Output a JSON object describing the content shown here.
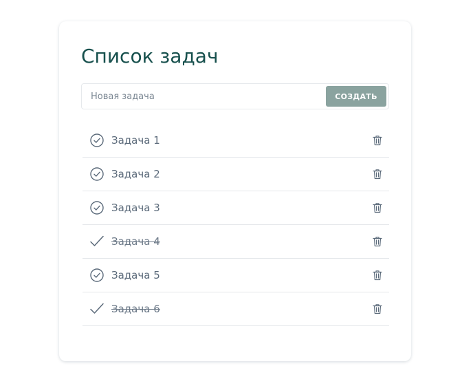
{
  "title": "Список задач",
  "new_task": {
    "placeholder": "Новая задача",
    "value": "",
    "button_label": "СОЗДАТЬ"
  },
  "colors": {
    "title": "#17504d",
    "button_bg": "#8aa39f",
    "icon": "#5b6a7a"
  },
  "tasks": [
    {
      "label": "Задача 1",
      "done": false,
      "status_icon": "circle-check-icon",
      "delete_icon": "trash-icon"
    },
    {
      "label": "Задача 2",
      "done": false,
      "status_icon": "circle-check-icon",
      "delete_icon": "trash-icon"
    },
    {
      "label": "Задача 3",
      "done": false,
      "status_icon": "circle-check-icon",
      "delete_icon": "trash-icon"
    },
    {
      "label": "Задача 4",
      "done": true,
      "status_icon": "check-icon",
      "delete_icon": "trash-icon"
    },
    {
      "label": "Задача 5",
      "done": false,
      "status_icon": "circle-check-icon",
      "delete_icon": "trash-icon"
    },
    {
      "label": "Задача 6",
      "done": true,
      "status_icon": "check-icon",
      "delete_icon": "trash-icon"
    }
  ]
}
